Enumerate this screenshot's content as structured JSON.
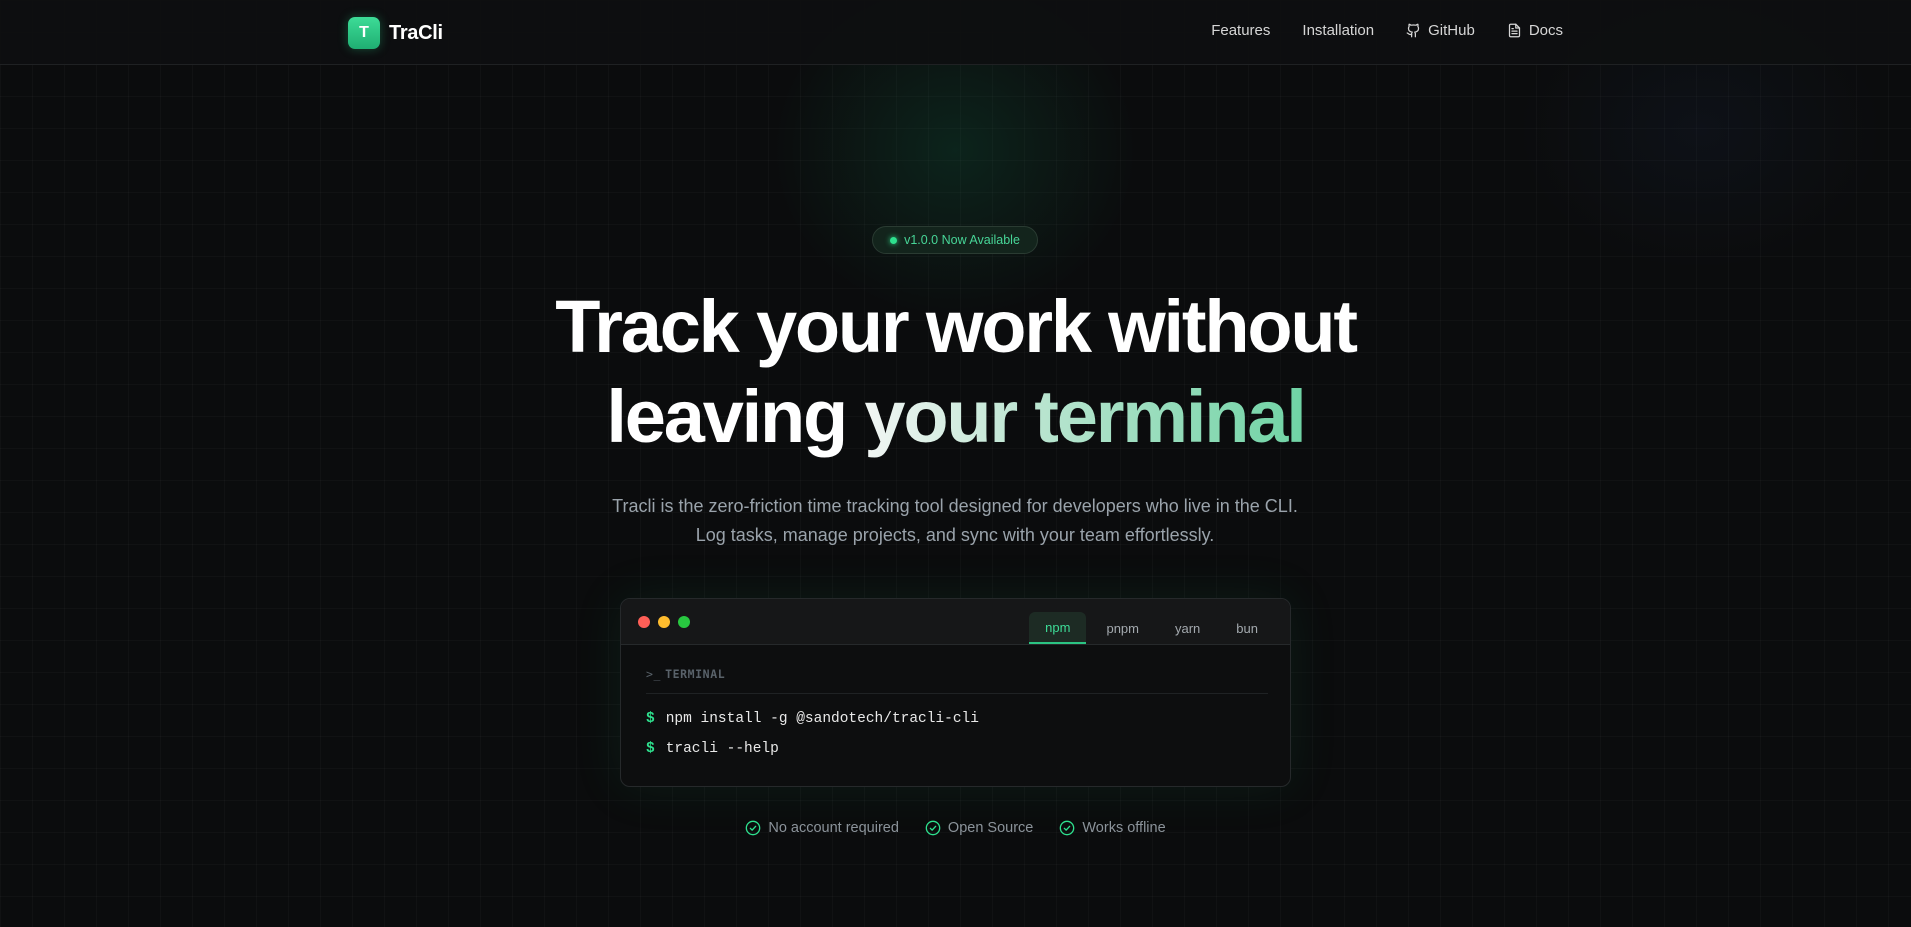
{
  "nav": {
    "brand_initial": "T",
    "brand_name": "TraCli",
    "links": [
      {
        "label": "Features",
        "icon": ""
      },
      {
        "label": "Installation",
        "icon": ""
      },
      {
        "label": "GitHub",
        "icon": "github-icon"
      },
      {
        "label": "Docs",
        "icon": "document-icon"
      }
    ]
  },
  "hero": {
    "badge": "v1.0.0 Now Available",
    "headline_line1": "Track your work without",
    "headline_line2_plain": "leaving ",
    "headline_line2_gradient": "your terminal",
    "subtitle": "Tracli is the zero-friction time tracking tool designed for developers who live in the CLI. Log tasks, manage projects, and sync with your team effortlessly."
  },
  "terminal": {
    "tabs": [
      "npm",
      "pnpm",
      "yarn",
      "bun"
    ],
    "active_tab": "npm",
    "prompt_glyph": ">_",
    "label": "TERMINAL",
    "commands": [
      {
        "prompt": "$",
        "text": "npm install -g @sandotech/tracli-cli"
      },
      {
        "prompt": "$",
        "text": "tracli --help"
      }
    ]
  },
  "features": [
    {
      "label": "No account required",
      "icon": "check-circle-icon"
    },
    {
      "label": "Open Source",
      "icon": "check-circle-icon"
    },
    {
      "label": "Works offline",
      "icon": "check-circle-icon"
    }
  ],
  "colors": {
    "accent": "#2ee08e",
    "background": "#0b0c0d"
  }
}
